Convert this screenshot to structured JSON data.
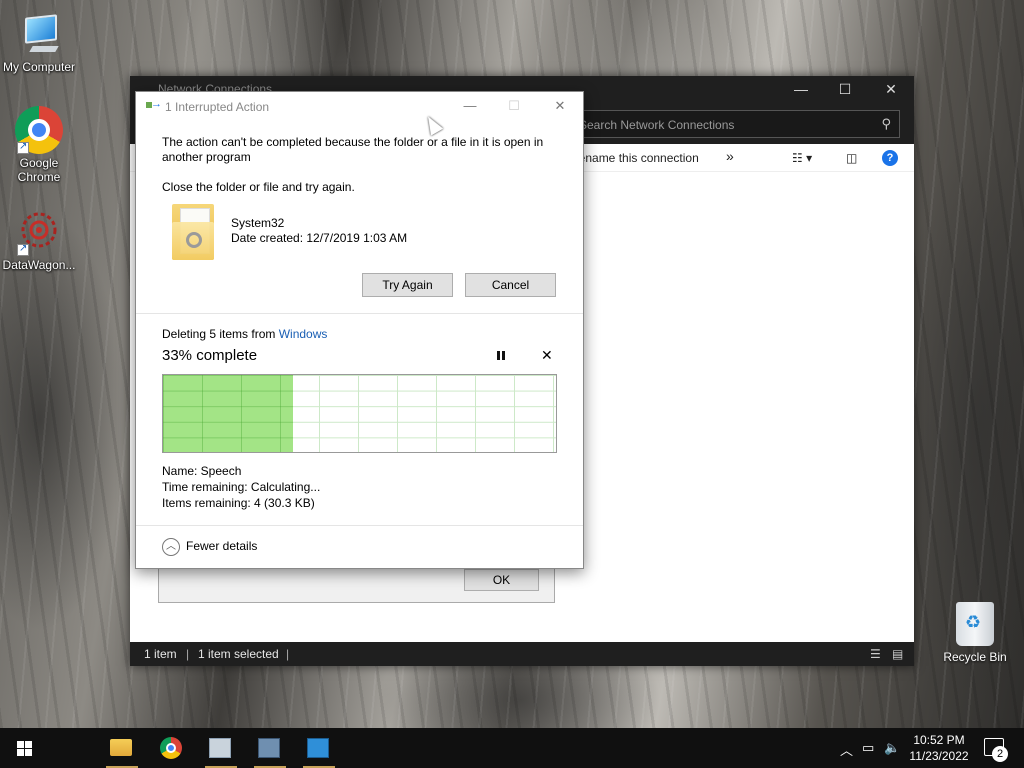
{
  "desktop": {
    "icons": [
      {
        "label": "My Computer",
        "icon": "computer-icon"
      },
      {
        "label": "Google Chrome",
        "icon": "chrome-icon"
      },
      {
        "label": "DataWagon...",
        "icon": "datawagon-icon"
      }
    ],
    "recycle_bin": "Recycle Bin"
  },
  "explorer": {
    "title": "Network Connections",
    "search_placeholder": "Search Network Connections",
    "rename": "Rename this connection",
    "more": "»",
    "status_items": "1 item",
    "status_selected": "1 item selected"
  },
  "behind_dialog": {
    "ok": "OK"
  },
  "dialog": {
    "title": "1 Interrupted Action",
    "message": "The action can't be completed because the folder or a file in it is open in another program",
    "instruction": "Close the folder or file and try again.",
    "file_name": "System32",
    "file_date": "Date created: 12/7/2019 1:03 AM",
    "try_again": "Try Again",
    "cancel": "Cancel",
    "deleting_prefix": "Deleting 5 items from ",
    "deleting_location": "Windows",
    "percent_text": "33% complete",
    "progress": 0.33,
    "name_line": "Name:  Speech",
    "time_line": "Time remaining:  Calculating...",
    "items_line": "Items remaining:  4 (30.3 KB)",
    "fewer_details": "Fewer details"
  },
  "taskbar": {
    "time": "10:52 PM",
    "date": "11/23/2022",
    "notifications": "2"
  },
  "colors": {
    "progress_fill": "#a3e486",
    "link": "#1a5fb4",
    "taskbar": "#101010"
  }
}
